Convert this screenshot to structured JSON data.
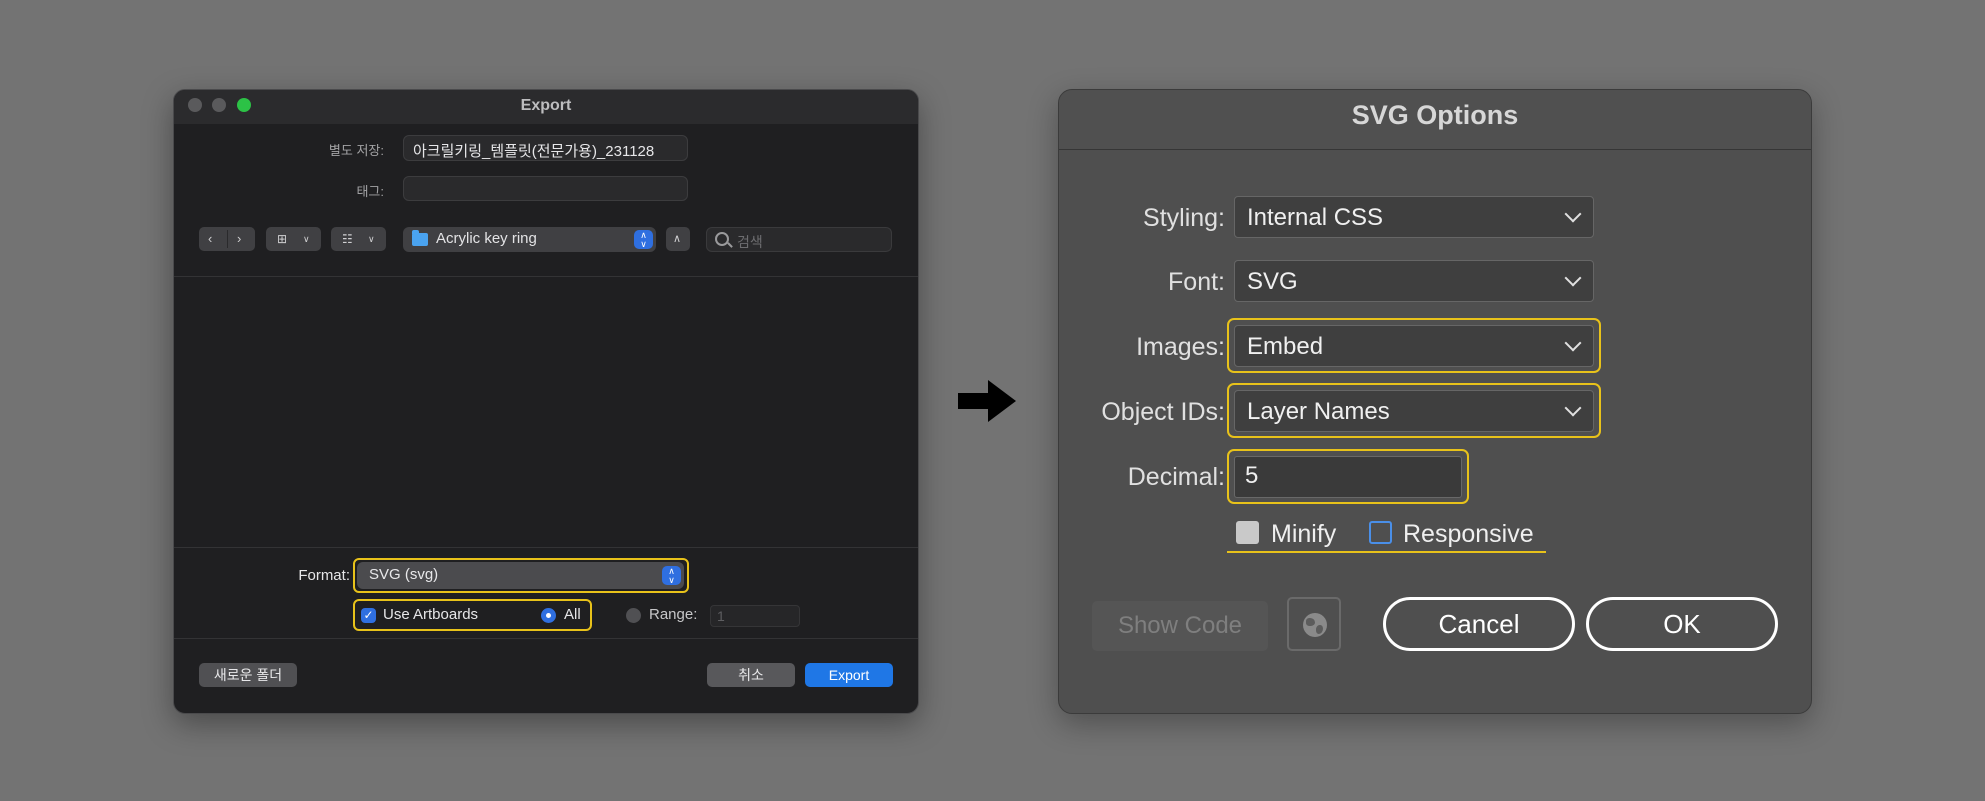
{
  "export_dialog": {
    "title": "Export",
    "save_as_label": "별도 저장:",
    "save_as_value": "아크릴키링_템플릿(전문가용)_231128",
    "tags_label": "태그:",
    "tags_value": "",
    "location": "Acrylic key ring",
    "search_placeholder": "검색",
    "format_label": "Format:",
    "format_value": "SVG (svg)",
    "use_artboards_label": "Use Artboards",
    "use_artboards_checked": true,
    "all_label": "All",
    "range_label": "Range:",
    "range_value": "1",
    "new_folder_label": "새로운 폴더",
    "cancel_label": "취소",
    "export_label": "Export"
  },
  "svg_options": {
    "title": "SVG Options",
    "styling_label": "Styling:",
    "styling_value": "Internal CSS",
    "font_label": "Font:",
    "font_value": "SVG",
    "images_label": "Images:",
    "images_value": "Embed",
    "object_ids_label": "Object IDs:",
    "object_ids_value": "Layer Names",
    "decimal_label": "Decimal:",
    "decimal_value": "5",
    "minify_label": "Minify",
    "responsive_label": "Responsive",
    "show_code_label": "Show Code",
    "cancel_label": "Cancel",
    "ok_label": "OK"
  },
  "icons": [
    "back-chevron-icon",
    "forward-chevron-icon",
    "grid-view-icon",
    "group-view-icon",
    "folder-icon",
    "up-chevron-icon",
    "search-icon",
    "arrow-right-icon",
    "globe-icon"
  ],
  "colors": {
    "highlight": "#e8c21a",
    "accent_blue": "#2f6fe0",
    "export_bg": "#1f1f21",
    "svg_bg": "#4f4f4f"
  }
}
